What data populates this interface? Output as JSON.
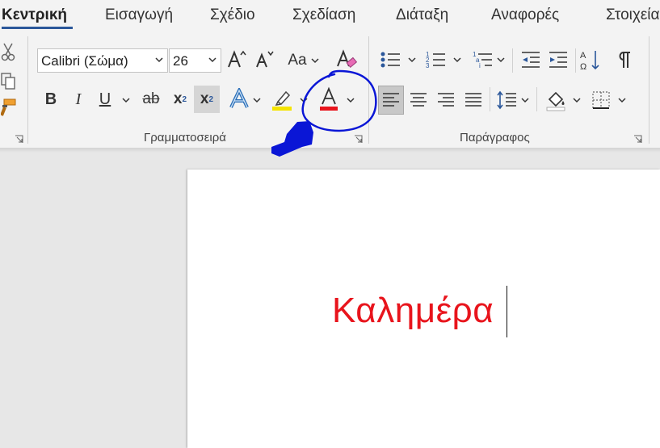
{
  "tabs": [
    {
      "label": "Κεντρική",
      "active": true
    },
    {
      "label": "Εισαγωγή"
    },
    {
      "label": "Σχέδιο"
    },
    {
      "label": "Σχεδίαση"
    },
    {
      "label": "Διάταξη"
    },
    {
      "label": "Αναφορές"
    },
    {
      "label": "Στοιχεία"
    }
  ],
  "font": {
    "family_value": "Calibri (Σώμα)",
    "size_value": "26",
    "change_case_label": "Aa",
    "group_label": "Γραμματοσειρά",
    "highlight_color": "#f5e400",
    "font_color": "#e8141c"
  },
  "buttons": {
    "bold": "B",
    "italic": "I",
    "underline": "U",
    "strike": "ab",
    "subscript_base": "x",
    "subscript_small": "2",
    "superscript_base": "x",
    "superscript_small": "2",
    "text_effects": "A",
    "font_color_letter": "A"
  },
  "paragraph": {
    "group_label": "Παράγραφος"
  },
  "document": {
    "text": "Καλημέρα",
    "text_color": "#e8141c"
  },
  "annotation": {
    "color": "#0a16d6"
  }
}
